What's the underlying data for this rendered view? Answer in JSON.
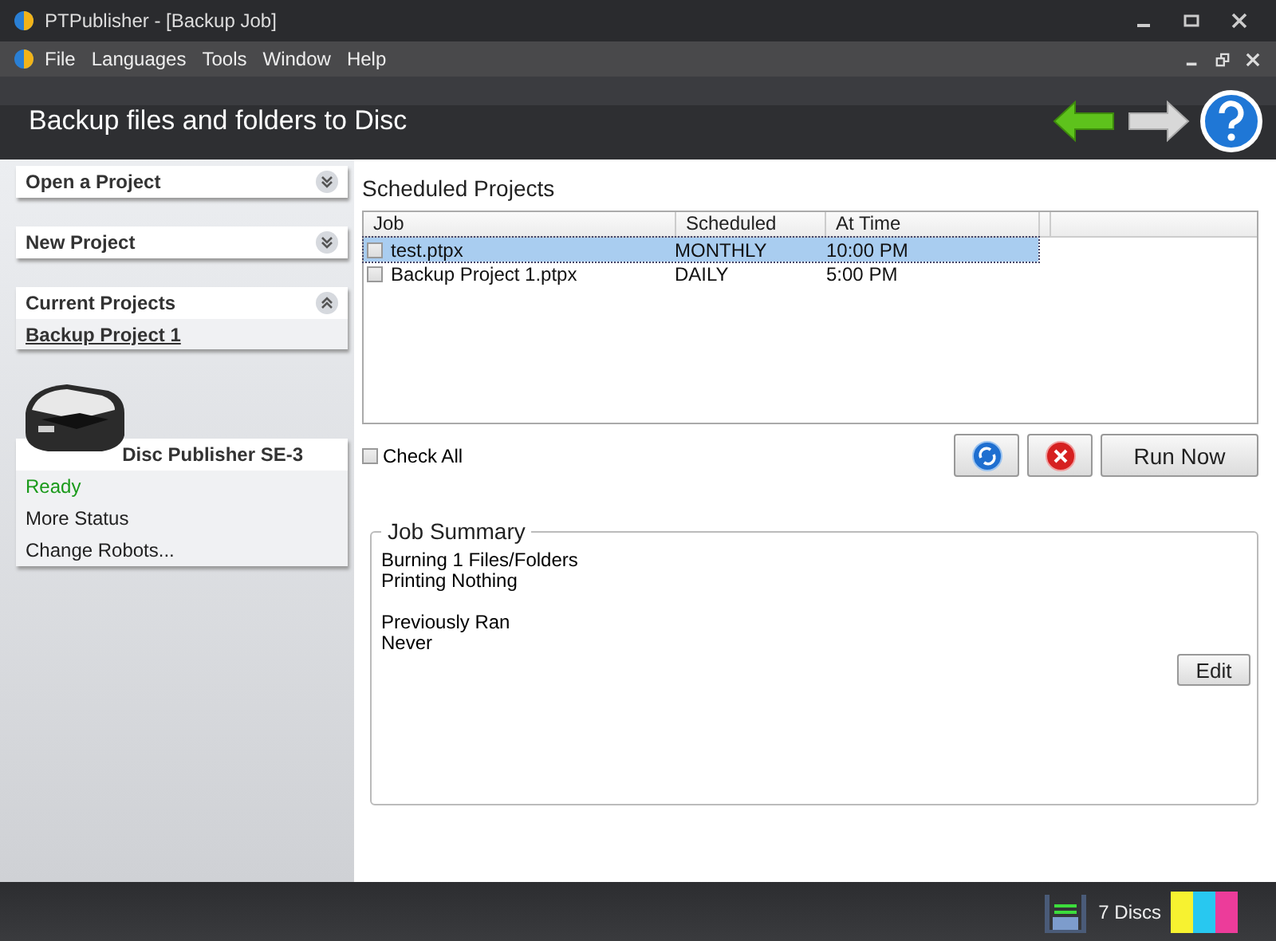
{
  "window": {
    "title": "PTPublisher - [Backup Job]"
  },
  "menu": [
    "File",
    "Languages",
    "Tools",
    "Window",
    "Help"
  ],
  "header": {
    "title": "Backup files and folders to Disc"
  },
  "sidebar": {
    "panels": [
      {
        "title": "Open a Project",
        "expanded": false
      },
      {
        "title": "New Project",
        "expanded": false
      },
      {
        "title": "Current Projects",
        "expanded": true,
        "items": [
          "Backup Project 1"
        ]
      }
    ],
    "robot": {
      "name": "Disc Publisher SE-3",
      "status": "Ready",
      "links": [
        "More Status",
        "Change Robots..."
      ]
    }
  },
  "scheduled": {
    "title": "Scheduled Projects",
    "columns": [
      "Job",
      "Scheduled",
      "At Time"
    ],
    "rows": [
      {
        "job": "test.ptpx",
        "scheduled": "MONTHLY",
        "time": "10:00 PM",
        "checked": false,
        "selected": true
      },
      {
        "job": "Backup Project 1.ptpx",
        "scheduled": "DAILY",
        "time": "5:00 PM",
        "checked": false,
        "selected": false
      }
    ],
    "check_all": {
      "label": "Check All",
      "checked": false
    },
    "run_button": "Run Now"
  },
  "summary": {
    "title": "Job Summary",
    "groups": [
      [
        "Burning 1 Files/Folders",
        "Printing Nothing"
      ],
      [
        "Previously Ran",
        "Never"
      ]
    ],
    "edit_button": "Edit"
  },
  "status_bar": {
    "discs": "7 Discs"
  }
}
